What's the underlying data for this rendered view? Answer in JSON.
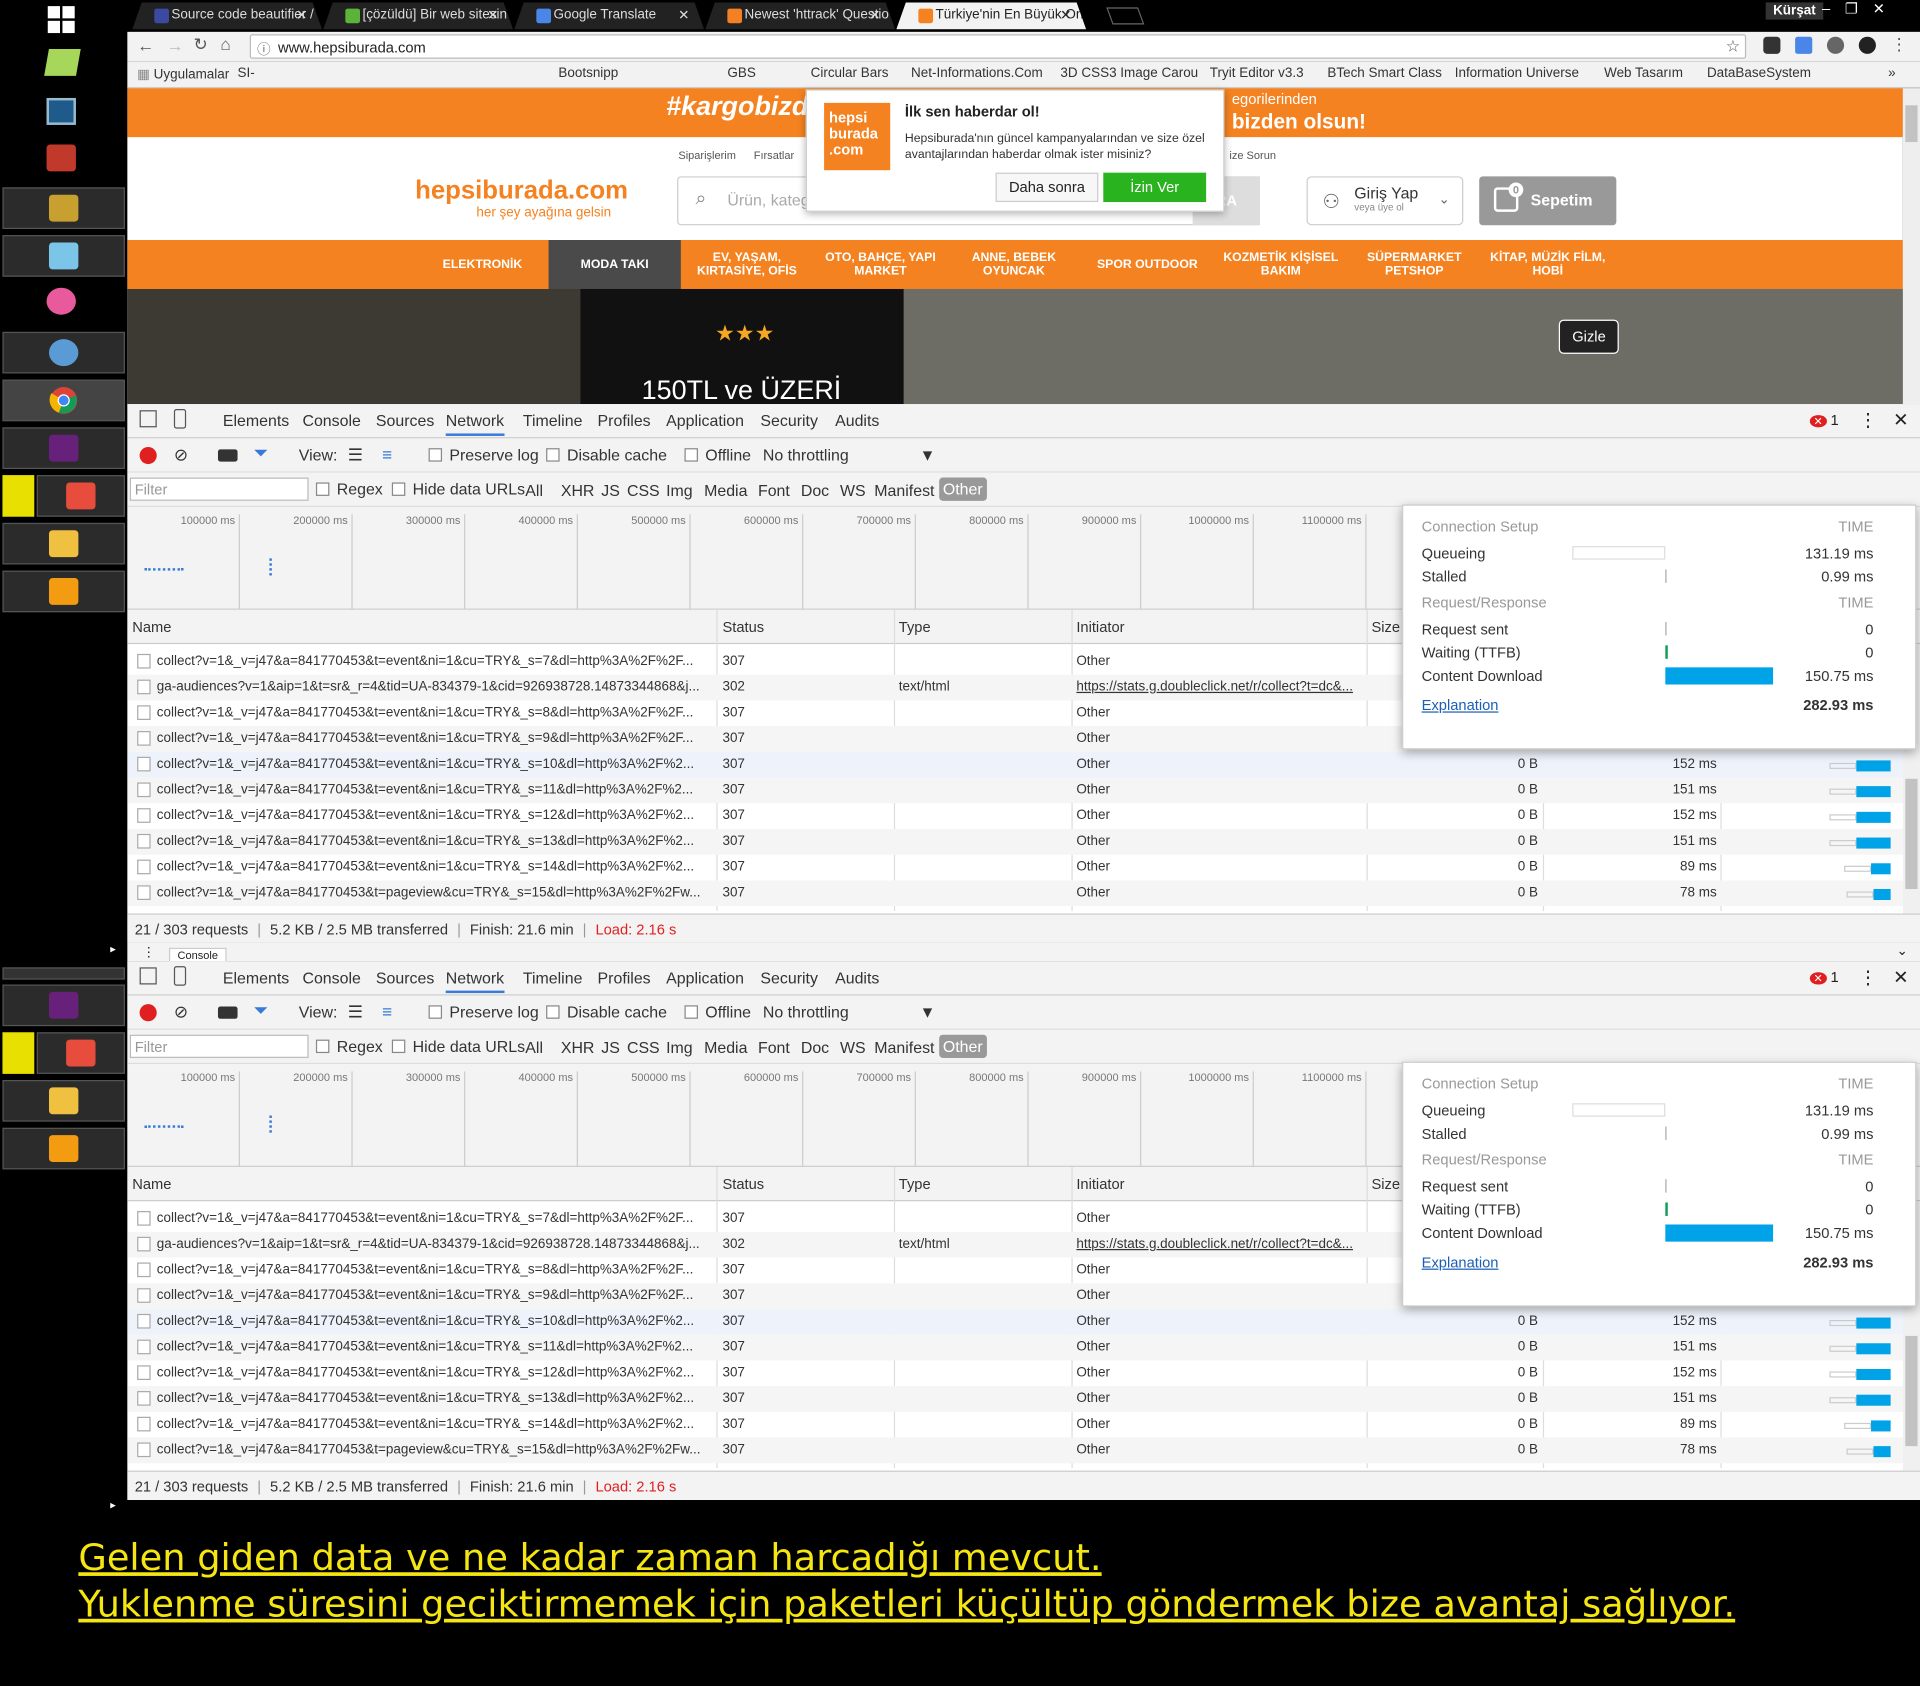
{
  "browser": {
    "tabs": [
      {
        "title": "Source code beautifier /",
        "color": "#3b4aa0"
      },
      {
        "title": "[çözüldü] Bir web sitesin",
        "color": "#5bb33a"
      },
      {
        "title": "Google Translate",
        "color": "#4a86e8"
      },
      {
        "title": "Newest 'httrack' Questio",
        "color": "#f48024"
      },
      {
        "title": "Türkiye'nin En Büyük Onl",
        "color": "#f58220"
      }
    ],
    "user": "Kürşat",
    "url": "www.hepsiburada.com",
    "bookmarks": [
      "Uygulamalar",
      "SI-",
      "Bootsnipp",
      "GBS",
      "Circular Bars",
      "Net-Informations.Com",
      "3D CSS3 Image Carou",
      "Tryit Editor v3.3",
      "BTech Smart Class",
      "Information Universe",
      "Web Tasarım",
      "DataBaseSystem"
    ]
  },
  "page": {
    "promo": "#kargobizde hareketi",
    "promo_right": "bizden olsun!",
    "promo_right_top": "egorilerinden",
    "toplinks": [
      "Siparişlerim",
      "Fırsatlar",
      "ize Sorun"
    ],
    "logo": "hepsiburada.com",
    "logo_sub": "her şey ayağına gelsin",
    "search_placeholder": "Ürün, kateg",
    "search_btn": "RA",
    "login": "Giriş Yap",
    "login_sub": "veya üye ol",
    "cart": "Sepetim",
    "cart_count": "0",
    "categories": [
      "ELEKTRONİK",
      "MODA TAKI",
      "EV, YAŞAM, KIRTASİYE, OFİS",
      "OTO, BAHÇE, YAPI MARKET",
      "ANNE, BEBEK OYUNCAK",
      "SPOR OUTDOOR",
      "KOZMETİK KİŞİSEL BAKIM",
      "SÜPERMARKET PETSHOP",
      "KİTAP, MÜZİK FİLM, HOBİ"
    ],
    "banner_text": "150TL ve ÜZERİ",
    "hide_button": "Gizle"
  },
  "notification": {
    "logo": "hepsi burada .com",
    "title": "İlk sen haberdar ol!",
    "message": "Hepsiburada'nın güncel kampanyalarından ve size özel avantajlarından haberdar olmak ister misiniz?",
    "later": "Daha sonra",
    "allow": "İzin Ver"
  },
  "devtools": {
    "tabs": [
      "Elements",
      "Console",
      "Sources",
      "Network",
      "Timeline",
      "Profiles",
      "Application",
      "Security",
      "Audits"
    ],
    "error_count": "1",
    "view_label": "View:",
    "preserve_log": "Preserve log",
    "disable_cache": "Disable cache",
    "offline": "Offline",
    "throttling": "No throttling",
    "filter_placeholder": "Filter",
    "regex": "Regex",
    "hide_data_urls": "Hide data URLs",
    "types": [
      "All",
      "XHR",
      "JS",
      "CSS",
      "Img",
      "Media",
      "Font",
      "Doc",
      "WS",
      "Manifest",
      "Other"
    ],
    "ticks": [
      "100000 ms",
      "200000 ms",
      "300000 ms",
      "400000 ms",
      "500000 ms",
      "600000 ms",
      "700000 ms",
      "800000 ms",
      "900000 ms",
      "1000000 ms",
      "1100000 ms"
    ],
    "columns": [
      "Name",
      "Status",
      "Type",
      "Initiator",
      "Size"
    ],
    "rows": [
      {
        "name": "collect?v=1&_v=j47&a=841770453&t=event&ni=1&cu=TRY&_s=7&dl=http%3A%2F%2F...",
        "status": "307",
        "type": "",
        "initiator": "Other",
        "size": "",
        "time": "",
        "bar": 0
      },
      {
        "name": "ga-audiences?v=1&aip=1&t=sr&_r=4&tid=UA-834379-1&cid=926938728.14873344868&j...",
        "status": "302",
        "type": "text/html",
        "initiator": "https://stats.g.doubleclick.net/r/collect?t=dc&...",
        "size": "",
        "time": "",
        "bar": 0
      },
      {
        "name": "collect?v=1&_v=j47&a=841770453&t=event&ni=1&cu=TRY&_s=8&dl=http%3A%2F%2F...",
        "status": "307",
        "type": "",
        "initiator": "Other",
        "size": "",
        "time": "",
        "bar": 0
      },
      {
        "name": "collect?v=1&_v=j47&a=841770453&t=event&ni=1&cu=TRY&_s=9&dl=http%3A%2F%2F...",
        "status": "307",
        "type": "",
        "initiator": "Other",
        "size": "",
        "time": "",
        "bar": 0
      },
      {
        "name": "collect?v=1&_v=j47&a=841770453&t=event&ni=1&cu=TRY&_s=10&dl=http%3A%2F%2...",
        "status": "307",
        "type": "",
        "initiator": "Other",
        "size": "0 B",
        "time": "152 ms",
        "bar": 152
      },
      {
        "name": "collect?v=1&_v=j47&a=841770453&t=event&ni=1&cu=TRY&_s=11&dl=http%3A%2F%2...",
        "status": "307",
        "type": "",
        "initiator": "Other",
        "size": "0 B",
        "time": "151 ms",
        "bar": 151
      },
      {
        "name": "collect?v=1&_v=j47&a=841770453&t=event&ni=1&cu=TRY&_s=12&dl=http%3A%2F%2...",
        "status": "307",
        "type": "",
        "initiator": "Other",
        "size": "0 B",
        "time": "152 ms",
        "bar": 152
      },
      {
        "name": "collect?v=1&_v=j47&a=841770453&t=event&ni=1&cu=TRY&_s=13&dl=http%3A%2F%2...",
        "status": "307",
        "type": "",
        "initiator": "Other",
        "size": "0 B",
        "time": "151 ms",
        "bar": 151
      },
      {
        "name": "collect?v=1&_v=j47&a=841770453&t=event&ni=1&cu=TRY&_s=14&dl=http%3A%2F%2...",
        "status": "307",
        "type": "",
        "initiator": "Other",
        "size": "0 B",
        "time": "89 ms",
        "bar": 89
      },
      {
        "name": "collect?v=1&_v=j47&a=841770453&t=pageview&cu=TRY&_s=15&dl=http%3A%2F%2Fw...",
        "status": "307",
        "type": "",
        "initiator": "Other",
        "size": "0 B",
        "time": "78 ms",
        "bar": 78
      }
    ],
    "summary": {
      "requests": "21 / 303 requests",
      "transferred": "5.2 KB / 2.5 MB transferred",
      "finish": "Finish: 21.6 min",
      "load": "Load: 2.16 s"
    },
    "timing": {
      "connection_setup": "Connection Setup",
      "time_label": "TIME",
      "request_response": "Request/Response",
      "queueing": "Queueing",
      "queueing_val": "131.19 ms",
      "stalled": "Stalled",
      "stalled_val": "0.99 ms",
      "request_sent": "Request sent",
      "request_sent_val": "0",
      "waiting": "Waiting (TTFB)",
      "waiting_val": "0",
      "download": "Content Download",
      "download_val": "150.75 ms",
      "explanation": "Explanation",
      "total": "282.93 ms"
    },
    "second_panel_tab": "Console"
  },
  "caption": {
    "line1": "Gelen giden data ve ne kadar zaman harcadığı mevcut.",
    "line2": "Yuklenme süresini geciktirmemek için paketleri küçültüp göndermek bize avantaj sağlıyor."
  },
  "colors": {
    "accent": "#f58220",
    "devtools_blue": "#3879d9",
    "bar_blue": "#00a2e8",
    "caption_yellow": "#f5e612",
    "load_red": "#e02020"
  }
}
